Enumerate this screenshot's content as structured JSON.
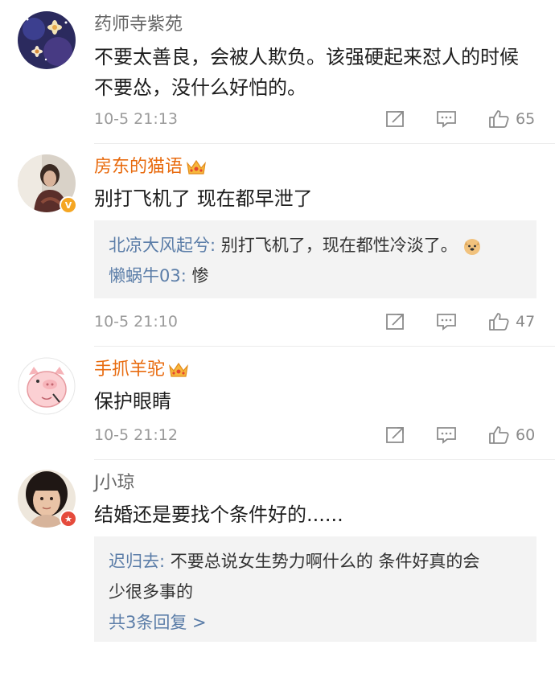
{
  "comments": [
    {
      "name": "药师寺紫苑",
      "text_line1": "不要太善良，会被人欺负。该强硬起来怼人的时候",
      "text_line2": "不要怂，没什么好怕的。",
      "time": "10-5 21:13",
      "likes": "65",
      "avatar_icon": "starry-night-flower-avatar"
    },
    {
      "name": "房东的猫语",
      "text_line1": "别打飞机了 现在都早泄了",
      "replies": [
        {
          "user": "北凉大风起兮:",
          "text": " 别打飞机了，现在都性冷淡了。"
        },
        {
          "user": "懒蜗牛03:",
          "text": " 惨"
        }
      ],
      "time": "10-5 21:10",
      "likes": "47",
      "badge": "V",
      "avatar_icon": "woman-photo-avatar"
    },
    {
      "name": "手抓羊驼",
      "text_line1": "保护眼睛",
      "time": "10-5 21:12",
      "likes": "60",
      "avatar_icon": "pink-pig-avatar"
    },
    {
      "name": "J小琼",
      "text_line1": "结婚还是要找个条件好的......",
      "replies": [
        {
          "user": "迟归去:",
          "text": " 不要总说女生势力啊什么的 条件好真的会"
        },
        {
          "user": "",
          "text": "少很多事的"
        }
      ],
      "more_replies": "共3条回复 >",
      "time": "",
      "likes": "",
      "badge": "★",
      "avatar_icon": "girl-photo-avatar"
    }
  ],
  "colors": {
    "vip_name": "#e86b0f",
    "reply_user": "#5b7da8",
    "meta_gray": "#9a9a9a",
    "reply_bg": "#f3f3f3"
  }
}
